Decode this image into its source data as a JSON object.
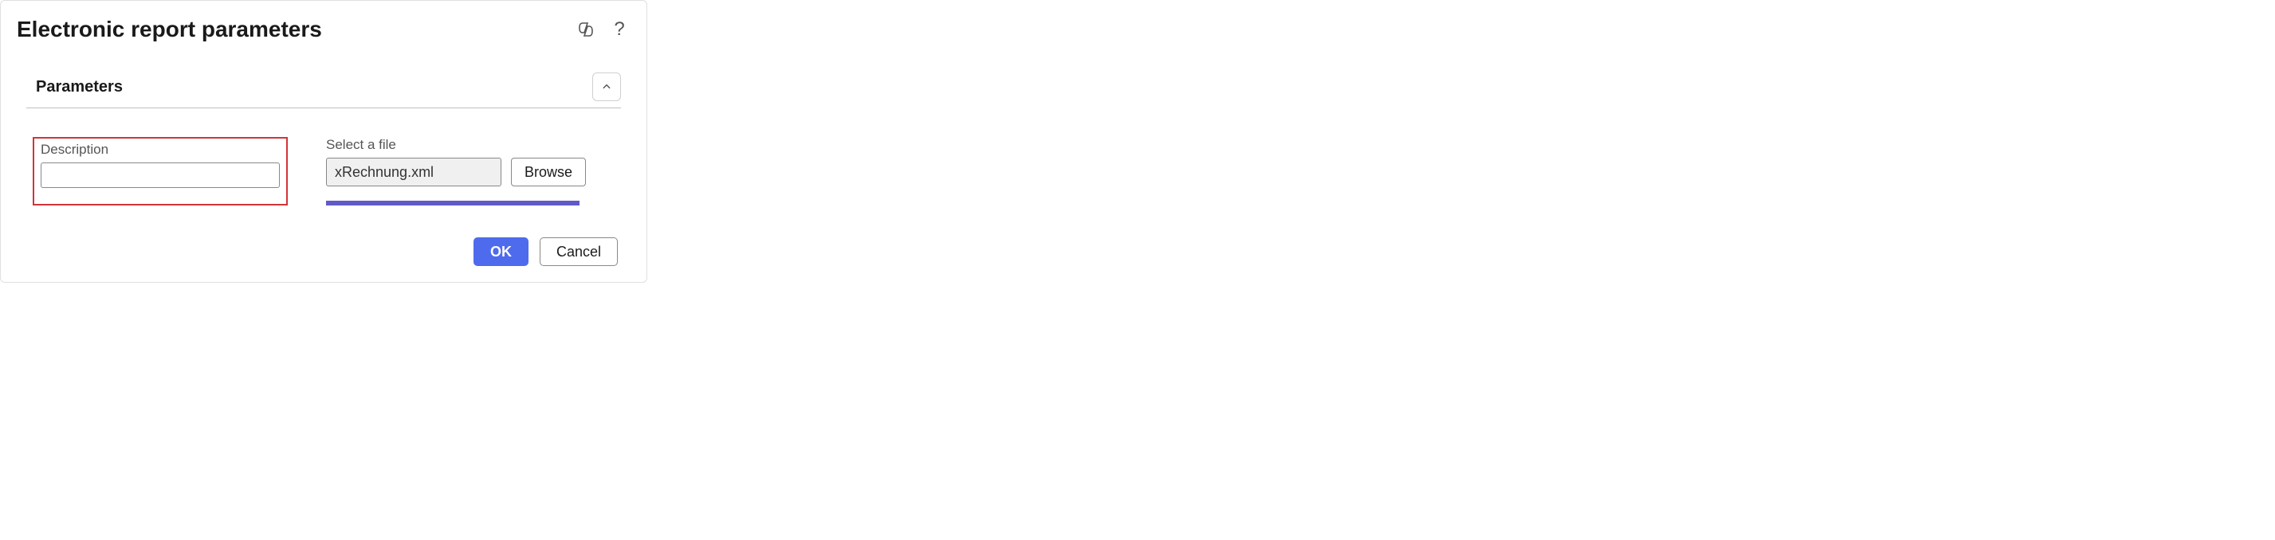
{
  "dialog": {
    "title": "Electronic report parameters"
  },
  "section": {
    "title": "Parameters"
  },
  "form": {
    "description_label": "Description",
    "description_value": "",
    "file_label": "Select a file",
    "file_value": "xRechnung.xml",
    "browse_label": "Browse"
  },
  "footer": {
    "ok_label": "OK",
    "cancel_label": "Cancel"
  }
}
